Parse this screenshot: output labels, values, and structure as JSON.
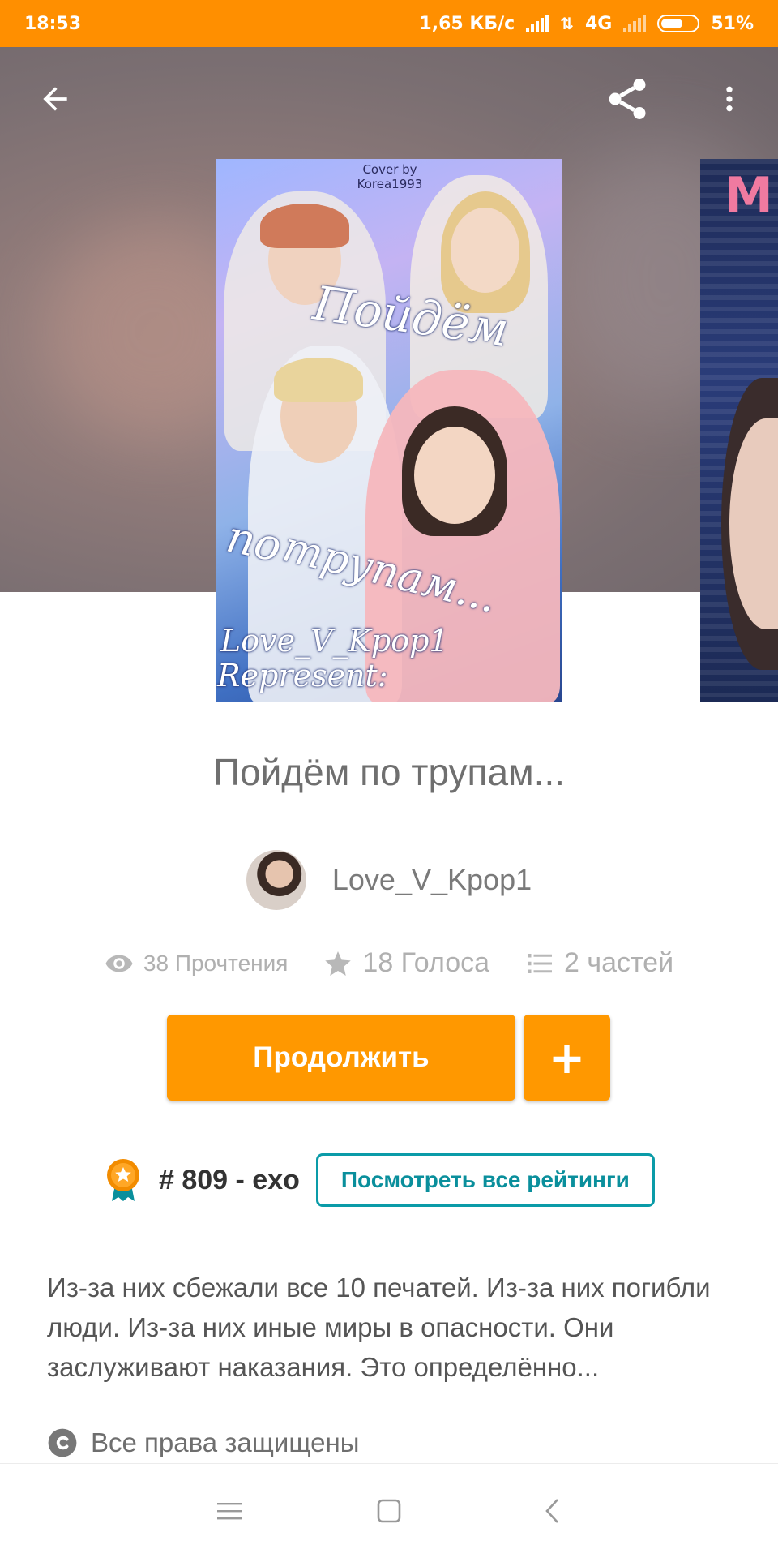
{
  "status_bar": {
    "time": "18:53",
    "network_speed": "1,65 КБ/с",
    "network_type": "4G",
    "battery": "51%"
  },
  "toolbar": {
    "back_icon": "arrow-left-icon",
    "share_icon": "share-icon",
    "more_icon": "more-vertical-icon"
  },
  "cover": {
    "credit_line1": "Cover by",
    "credit_line2": "Korea1993",
    "title_line1": "Пойдём",
    "title_line2": "по",
    "title_line3": "трупам...",
    "author_line1": "Love_V_Kpop1",
    "author_line2": "Represent:"
  },
  "next_cover": {
    "title": "M"
  },
  "story": {
    "title": "Пойдём по трупам...",
    "author": "Love_V_Kpop1",
    "reads": "38 Прочтения",
    "votes": "18 Голоса",
    "parts": "2 частей",
    "description": "Из-за них сбежали все 10 печатей. Из-за них погибли люди. Из-за них иные миры в опасности. Они заслуживают наказания. Это определённо...",
    "copyright": "Все права защищены"
  },
  "actions": {
    "continue_label": "Продолжить",
    "add_label": "+"
  },
  "ranking": {
    "rank": "# 809 - exo",
    "view_all_label": "Посмотреть все рейтинги"
  },
  "colors": {
    "accent": "#ff9800",
    "status_bar": "#ff8f00",
    "teal": "#0a9ba8"
  },
  "nav_bar": {
    "menu_icon": "menu-icon",
    "home_icon": "square-icon",
    "back_icon": "chevron-left-icon"
  }
}
